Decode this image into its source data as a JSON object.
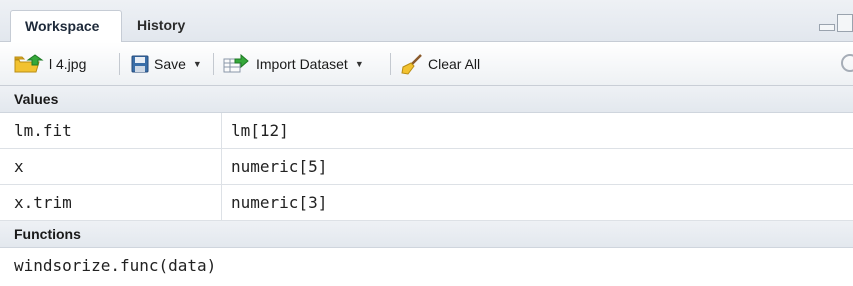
{
  "tabs": [
    {
      "label": "Workspace",
      "active": true
    },
    {
      "label": "History",
      "active": false
    }
  ],
  "toolbar": {
    "load_label": "l 4.jpg",
    "save_label": "Save",
    "import_label": "Import Dataset",
    "clear_label": "Clear All"
  },
  "values_section": {
    "header": "Values",
    "rows": [
      {
        "name": "lm.fit",
        "value": "lm[12]"
      },
      {
        "name": "x",
        "value": "numeric[5]"
      },
      {
        "name": "x.trim",
        "value": "numeric[3]"
      }
    ]
  },
  "functions_section": {
    "header": "Functions",
    "rows": [
      {
        "name": "windsorize.func(data)"
      }
    ]
  },
  "colors": {
    "header_bg": "#e6eaf0",
    "border": "#c6ccd5",
    "folder_yellow": "#f2c230",
    "arrow_green": "#35a83a",
    "save_blue": "#3a6ea8"
  }
}
